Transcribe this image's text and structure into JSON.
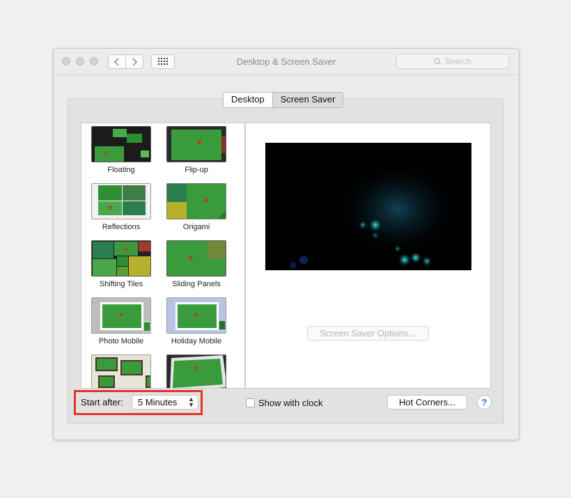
{
  "window": {
    "title": "Desktop & Screen Saver",
    "search_placeholder": "Search"
  },
  "tabs": [
    {
      "label": "Desktop",
      "selected": false
    },
    {
      "label": "Screen Saver",
      "selected": true
    }
  ],
  "screensavers": [
    {
      "label": "Floating",
      "thumb": "floating"
    },
    {
      "label": "Flip-up",
      "thumb": "flipup"
    },
    {
      "label": "Reflections",
      "thumb": "reflections"
    },
    {
      "label": "Origami",
      "thumb": "origami"
    },
    {
      "label": "Shifting Tiles",
      "thumb": "shifting"
    },
    {
      "label": "Sliding Panels",
      "thumb": "sliding"
    },
    {
      "label": "Photo Mobile",
      "thumb": "photomobile"
    },
    {
      "label": "Holiday Mobile",
      "thumb": "holiday"
    },
    {
      "label": "",
      "thumb": "wall"
    },
    {
      "label": "",
      "thumb": "vintage"
    }
  ],
  "preview": {
    "options_button": "Screen Saver Options..."
  },
  "bottom": {
    "start_after_label": "Start after:",
    "start_after_value": "5 Minutes",
    "show_clock_label": "Show with clock",
    "show_clock_checked": false,
    "hot_corners_button": "Hot Corners...",
    "help_button": "?"
  },
  "colors": {
    "highlight": "#e5332a",
    "leaf_green": "#3a9b3d",
    "glow": "#21d3d6"
  }
}
